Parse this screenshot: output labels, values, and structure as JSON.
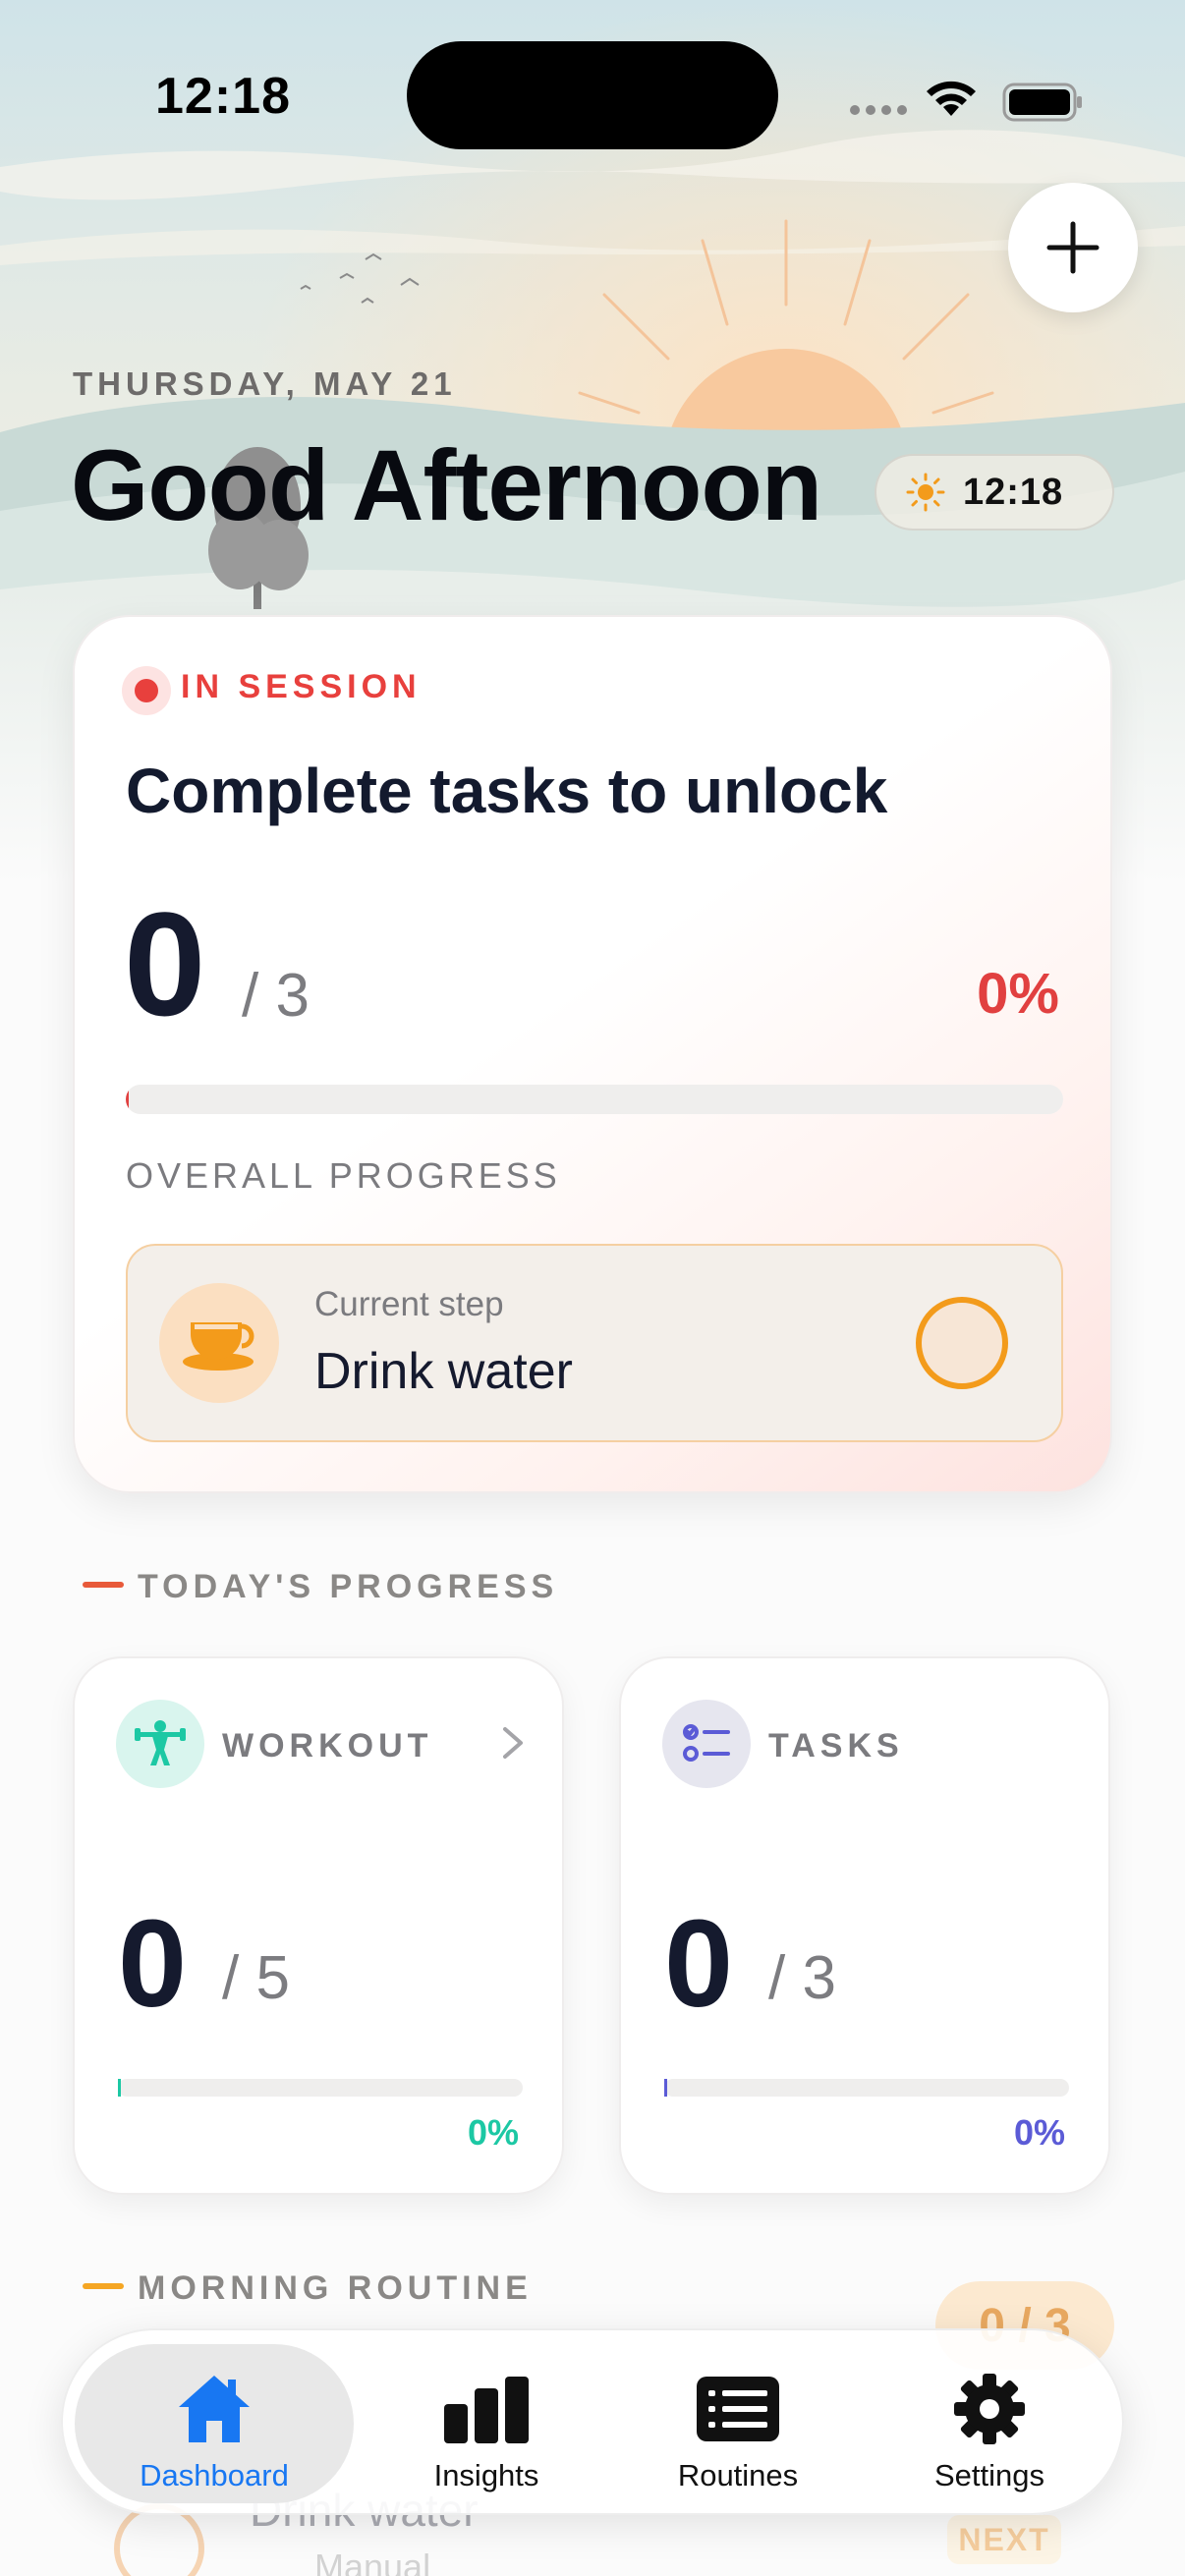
{
  "status_bar": {
    "time": "12:18"
  },
  "header": {
    "date": "THURSDAY, MAY 21",
    "greeting": "Good Afternoon",
    "time_pill": "12:18",
    "add_button_icon": "plus-icon"
  },
  "session": {
    "status": "IN SESSION",
    "title": "Complete tasks to unlock",
    "completed": "0",
    "total": "/ 3",
    "percent_label": "0%",
    "progress_fraction": 0,
    "progress_label": "OVERALL PROGRESS",
    "current_step": {
      "label": "Current step",
      "name": "Drink water",
      "icon": "coffee-cup-icon"
    }
  },
  "todays_progress": {
    "title": "TODAY'S PROGRESS",
    "cards": [
      {
        "label": "WORKOUT",
        "icon": "weightlifter-icon",
        "value": "0",
        "total": "/ 5",
        "percent_label": "0%",
        "progress_fraction": 0,
        "color": "#1cc8a4"
      },
      {
        "label": "TASKS",
        "icon": "checklist-icon",
        "value": "0",
        "total": "/ 3",
        "percent_label": "0%",
        "progress_fraction": 0,
        "color": "#5b5bd6"
      }
    ]
  },
  "morning_routine": {
    "title": "MORNING ROUTINE",
    "count": "0 / 3",
    "item_name": "Drink water",
    "item_sub": "Manual",
    "next_badge": "NEXT"
  },
  "tab_bar": {
    "active_color": "#1877f2",
    "tabs": [
      {
        "label": "Dashboard",
        "icon": "house-icon",
        "active": true
      },
      {
        "label": "Insights",
        "icon": "bar-chart-icon",
        "active": false
      },
      {
        "label": "Routines",
        "icon": "list-icon",
        "active": false
      },
      {
        "label": "Settings",
        "icon": "gear-icon",
        "active": false
      }
    ]
  },
  "colors": {
    "session_accent": "#e8403d",
    "step_accent": "#f39b1b",
    "section_bar_progress": "#e85a3a",
    "section_bar_routine": "#f5a623"
  }
}
